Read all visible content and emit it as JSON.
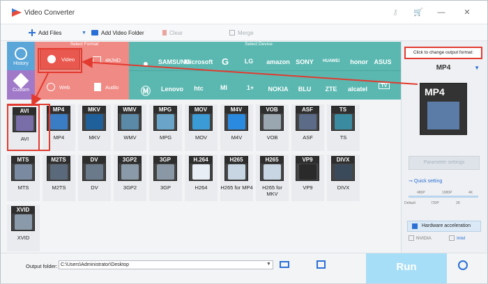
{
  "window": {
    "title": "Video Converter"
  },
  "toolbar": {
    "add_files": "Add Files",
    "add_video_folder": "Add Video Folder",
    "clear": "Clear",
    "merge": "Merge"
  },
  "sections": {
    "select_format": "Select Format",
    "select_device": "Select Device"
  },
  "side_tabs": {
    "history": "History",
    "custom": "Custom"
  },
  "format_types": {
    "video": "Video",
    "fourk": "4K/HD",
    "web": "Web",
    "audio": "Audio"
  },
  "devices_row1": [
    "SAMSUNG",
    "Microsoft",
    "G",
    "LG",
    "amazon",
    "SONY",
    "HUAWEI",
    "honor",
    "ASUS"
  ],
  "devices_row2": [
    "Lenovo",
    "htc",
    "MI",
    "1+",
    "NOKIA",
    "BLU",
    "ZTE",
    "alcatel",
    "TV"
  ],
  "formats": [
    {
      "tag": "AVI",
      "name": "AVI"
    },
    {
      "tag": "MP4",
      "name": "MP4"
    },
    {
      "tag": "MKV",
      "name": "MKV"
    },
    {
      "tag": "WMV",
      "name": "WMV"
    },
    {
      "tag": "MPG",
      "name": "MPG"
    },
    {
      "tag": "MOV",
      "name": "MOV"
    },
    {
      "tag": "M4V",
      "name": "M4V"
    },
    {
      "tag": "VOB",
      "name": "VOB"
    },
    {
      "tag": "ASF",
      "name": "ASF"
    },
    {
      "tag": "TS",
      "name": "TS"
    },
    {
      "tag": "MTS",
      "name": "MTS"
    },
    {
      "tag": "M2TS",
      "name": "M2TS"
    },
    {
      "tag": "DV",
      "name": "DV"
    },
    {
      "tag": "3GP2",
      "name": "3GP2"
    },
    {
      "tag": "3GP",
      "name": "3GP"
    },
    {
      "tag": "H.264",
      "name": "H264"
    },
    {
      "tag": "H265",
      "name": "H265 for MP4"
    },
    {
      "tag": "H265",
      "name": "H265 for MKV"
    },
    {
      "tag": "VP9",
      "name": "VP9"
    },
    {
      "tag": "DIVX",
      "name": "DIVX"
    },
    {
      "tag": "XVID",
      "name": "XVID"
    }
  ],
  "right": {
    "click_hint": "Click to change output format:",
    "output_format": "MP4",
    "parameter_settings": "Parameter settings",
    "quick_setting": "Quick setting",
    "q_top": [
      "480P",
      "1080P",
      "4K"
    ],
    "q_bottom": [
      "Default",
      "720P",
      "2K"
    ],
    "hw_accel": "Hardware acceleration",
    "nvidia": "NVIDIA",
    "intel": "Intel"
  },
  "bottom": {
    "output_label": "Output folder:",
    "output_path": "C:\\Users\\Administrator\\Desktop",
    "run": "Run"
  },
  "colors": {
    "accent": "#2a6fd6",
    "highlight": "#e23a2f",
    "format_bg": "#f08a84",
    "device_bg": "#5ab8b1"
  }
}
